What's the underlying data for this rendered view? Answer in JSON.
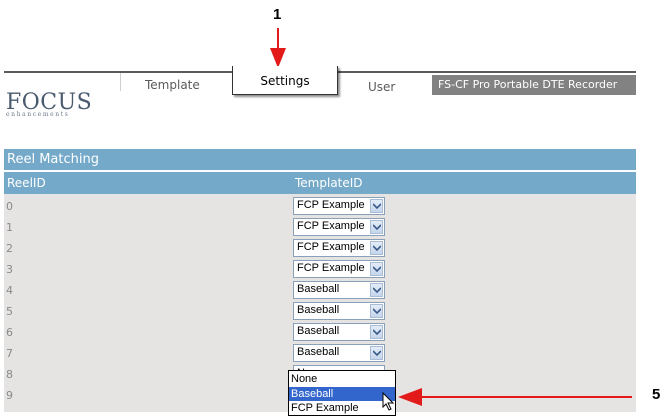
{
  "callouts": {
    "first": "1",
    "second": "5"
  },
  "logo": {
    "main": "FOCUS",
    "sub": "enhancements"
  },
  "tabs": {
    "template": "Template",
    "settings": "Settings",
    "user": "User"
  },
  "product": "FS-CF Pro Portable DTE Recorder",
  "panel": {
    "title": "Reel Matching"
  },
  "columns": {
    "reel": "ReelID",
    "template": "TemplateID"
  },
  "rows": [
    {
      "id": "0",
      "template": "FCP Example"
    },
    {
      "id": "1",
      "template": "FCP Example"
    },
    {
      "id": "2",
      "template": "FCP Example"
    },
    {
      "id": "3",
      "template": "FCP Example"
    },
    {
      "id": "4",
      "template": "Baseball"
    },
    {
      "id": "5",
      "template": "Baseball"
    },
    {
      "id": "6",
      "template": "Baseball"
    },
    {
      "id": "7",
      "template": "Baseball"
    },
    {
      "id": "8",
      "template": "N"
    },
    {
      "id": "9",
      "template": ""
    }
  ],
  "dropdown": {
    "options": [
      "None",
      "Baseball",
      "FCP Example"
    ],
    "highlighted": "Baseball"
  },
  "colors": {
    "header_blue": "#74a9c9",
    "row_bg": "#e6e3e3",
    "arrow_red": "#e21a1a",
    "highlight": "#3366cc"
  }
}
